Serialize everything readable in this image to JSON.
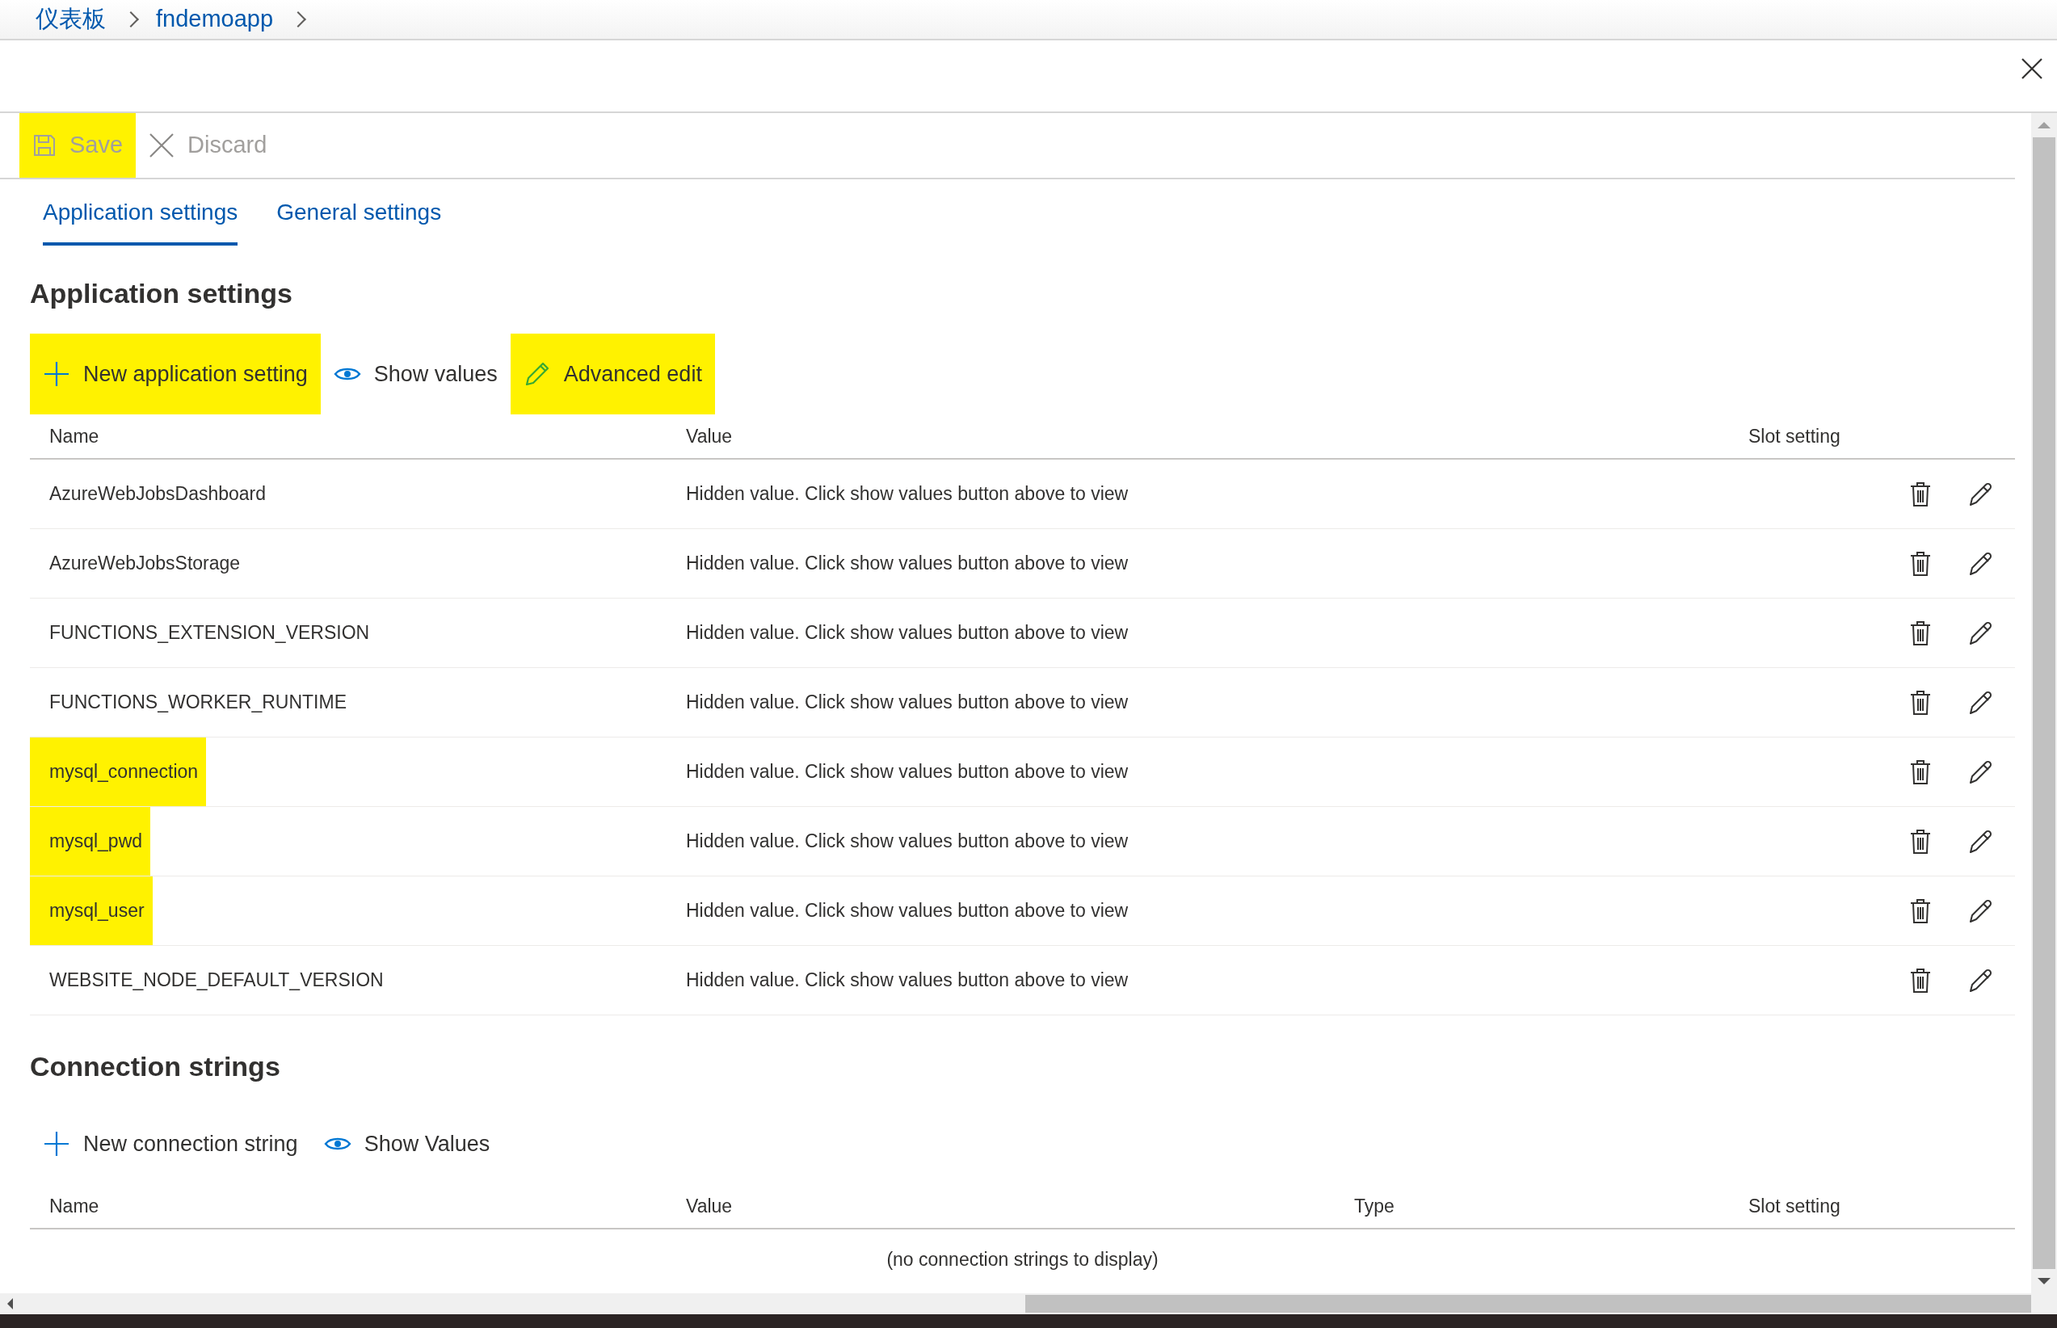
{
  "breadcrumb": [
    {
      "label": "仪表板"
    },
    {
      "label": "fndemoapp"
    }
  ],
  "toolbar": [
    {
      "kind": "save",
      "label": "Save",
      "disabled": true,
      "highlighted": true
    },
    {
      "kind": "discard",
      "label": "Discard",
      "disabled": true,
      "highlighted": false
    }
  ],
  "tabs": [
    {
      "label": "Application settings",
      "selected": true
    },
    {
      "label": "General settings",
      "selected": false
    }
  ],
  "app_settings": {
    "title": "Application settings",
    "actions": [
      {
        "kind": "add",
        "label": "New application setting",
        "highlighted": true
      },
      {
        "kind": "show",
        "label": "Show values",
        "highlighted": false
      },
      {
        "kind": "edit",
        "label": "Advanced edit",
        "highlighted": true
      }
    ],
    "columns": [
      "Name",
      "Value",
      "Slot setting"
    ],
    "rows": [
      {
        "name": "AzureWebJobsDashboard",
        "value": "Hidden value. Click show values button above to view",
        "highlighted": false
      },
      {
        "name": "AzureWebJobsStorage",
        "value": "Hidden value. Click show values button above to view",
        "highlighted": false
      },
      {
        "name": "FUNCTIONS_EXTENSION_VERSION",
        "value": "Hidden value. Click show values button above to view",
        "highlighted": false
      },
      {
        "name": "FUNCTIONS_WORKER_RUNTIME",
        "value": "Hidden value. Click show values button above to view",
        "highlighted": false
      },
      {
        "name": "mysql_connection",
        "value": "Hidden value. Click show values button above to view",
        "highlighted": true
      },
      {
        "name": "mysql_pwd",
        "value": "Hidden value. Click show values button above to view",
        "highlighted": true
      },
      {
        "name": "mysql_user",
        "value": "Hidden value. Click show values button above to view",
        "highlighted": true
      },
      {
        "name": "WEBSITE_NODE_DEFAULT_VERSION",
        "value": "Hidden value. Click show values button above to view",
        "highlighted": false
      }
    ]
  },
  "connection_strings": {
    "title": "Connection strings",
    "actions": [
      {
        "kind": "add",
        "label": "New connection string",
        "highlighted": false
      },
      {
        "kind": "show",
        "label": "Show Values",
        "highlighted": false
      }
    ],
    "columns": [
      "Name",
      "Value",
      "Type",
      "Slot setting"
    ],
    "empty_message": "(no connection strings to display)"
  }
}
